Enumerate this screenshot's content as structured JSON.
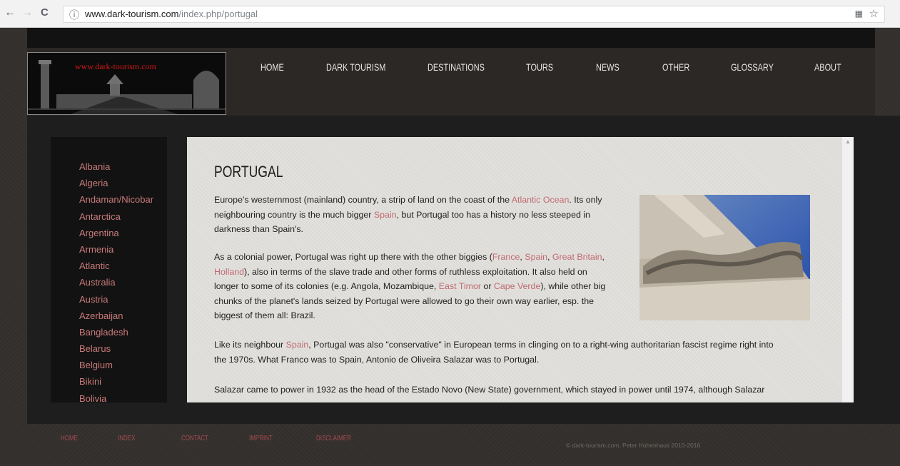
{
  "browser": {
    "back_icon": "←",
    "forward_icon": "→",
    "reload_icon": "C",
    "info_icon": "ⓘ",
    "url_host": "www.dark-tourism.com",
    "url_path": "/index.php/portugal",
    "translate_icon": "▦",
    "star_icon": "☆"
  },
  "logo": {
    "text": "www.dark-tourism.com"
  },
  "nav": [
    "HOME",
    "DARK TOURISM",
    "DESTINATIONS",
    "TOURS",
    "NEWS",
    "OTHER",
    "GLOSSARY",
    "ABOUT"
  ],
  "sidebar": [
    "Albania",
    "Algeria",
    "Andaman/Nicobar",
    "Antarctica",
    "Argentina",
    "Armenia",
    "Atlantic",
    "Australia",
    "Austria",
    "Azerbaijan",
    "Bangladesh",
    "Belarus",
    "Belgium",
    "Bikini",
    "Bolivia"
  ],
  "article": {
    "title": "PORTUGAL",
    "p1": {
      "line1_a": "Europe's westernmost (mainland) country, a strip of land on the coast of the ",
      "link_atlantic": "Atlantic Ocean",
      "line1_b": ". Its only",
      "line2_a": "neighbouring country is the much bigger ",
      "link_spain": "Spain",
      "line2_b": ", but Portugal too has a history no less steeped in",
      "line3": "darkness than Spain's."
    },
    "p2": {
      "line1_a": "As a colonial power, Portugal was right up there with the other biggies (",
      "link_france": "France",
      "sep1": ", ",
      "link_spain": "Spain",
      "sep2": ", ",
      "link_gb": "Great Britain",
      "sep3": ",",
      "link_holland": "Holland",
      "line2_b": "), also in terms of the slave trade and other forms of ruthless exploitation. It also held on",
      "line3_a": "longer to some of its colonies (e.g. Angola, Mozambique, ",
      "link_timor": "East Timor",
      "or": " or ",
      "link_cape": "Cape Verde",
      "line3_b": "), while other big",
      "line4": "chunks of the planet's lands seized by Portugal were allowed to go their own way earlier, esp. the",
      "line5": "biggest of them all: Brazil."
    },
    "p3": {
      "line1_a": "Like its neighbour ",
      "link_spain": "Spain",
      "line1_b": ", Portugal was also \"conservative\" in European terms in clinging on to a right-wing authoritarian fascist regime right into",
      "line2": "the 1970s. What Franco was to Spain, Antonio de Oliveira Salazar was to Portugal."
    },
    "p4": {
      "line1": "Salazar came to power in 1932 as the head of the Estado Novo (New State) government, which stayed in power until 1974, although Salazar"
    }
  },
  "footer": {
    "links": [
      "HOME",
      "INDEX",
      "CONTACT",
      "IMPRINT",
      "DISCLAIMER"
    ],
    "copyright": "© dark-tourism.com, Peter Hohenhaus 2010-2016"
  },
  "colors": {
    "link": "#c06a72",
    "sidebar_link": "#c97a7a",
    "footer_link": "#a24a50"
  }
}
